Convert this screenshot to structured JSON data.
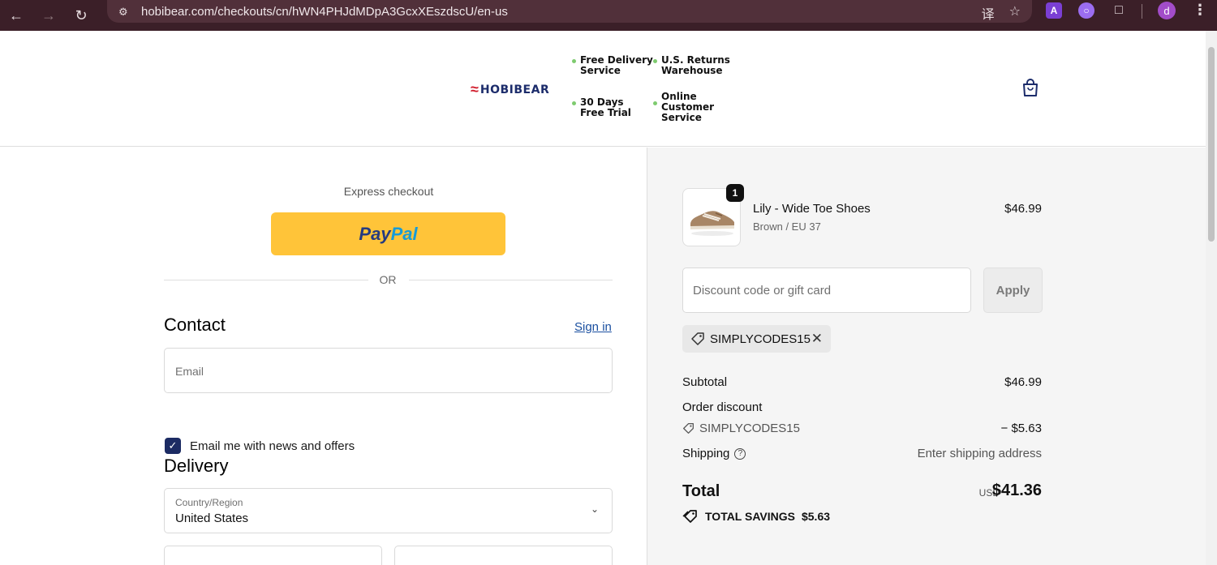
{
  "browser": {
    "url": "hobibear.com/checkouts/cn/hWN4PHJdMDpA3GcxXEszdscU/en-us",
    "profile_initial": "d",
    "extension_a_label": "A"
  },
  "header": {
    "brand": "HOBIBEAR",
    "features": [
      {
        "line1": "Free Delivery",
        "line2": "Service",
        "line3": ""
      },
      {
        "line1": "U.S. Returns",
        "line2": "Warehouse",
        "line3": ""
      },
      {
        "line1": "30 Days",
        "line2": "Free Trial",
        "line3": ""
      },
      {
        "line1": "Online",
        "line2": "Customer",
        "line3": "Service"
      }
    ]
  },
  "checkout": {
    "express_label": "Express checkout",
    "paypal_pay": "Pay",
    "paypal_pal": "Pal",
    "or_label": "OR",
    "contact_title": "Contact",
    "sign_in": "Sign in",
    "email_placeholder": "Email",
    "news_checkbox_label": "Email me with news and offers",
    "news_checked": true,
    "delivery_title": "Delivery",
    "country_label": "Country/Region",
    "country_value": "United States"
  },
  "summary": {
    "item": {
      "name": "Lily - Wide Toe Shoes",
      "variant": "Brown / EU 37",
      "price": "$46.99",
      "quantity": "1"
    },
    "discount_placeholder": "Discount code or gift card",
    "apply_label": "Apply",
    "applied_code": "SIMPLYCODES15",
    "subtotal_label": "Subtotal",
    "subtotal_value": "$46.99",
    "order_discount_label": "Order discount",
    "discount_code": "SIMPLYCODES15",
    "discount_value": "− $5.63",
    "shipping_label": "Shipping",
    "shipping_value": "Enter shipping address",
    "total_label": "Total",
    "currency": "USD",
    "total_value": "$41.36",
    "savings_label": "TOTAL SAVINGS",
    "savings_value": "$5.63"
  },
  "colors": {
    "chrome_bg": "#3b1f28",
    "paypal": "#ffc439",
    "brand_navy": "#1c2c6b",
    "brand_red": "#d11d2d",
    "checkbox": "#1c2b63",
    "feature_dot": "#7ecb6f"
  }
}
